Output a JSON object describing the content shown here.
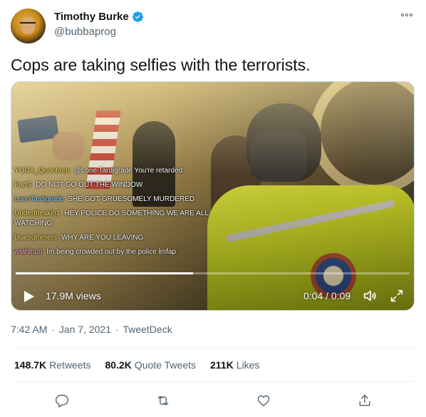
{
  "author": {
    "name": "Timothy Burke",
    "handle": "@bubbaprog",
    "verified": true
  },
  "tweet": {
    "text": "Cops are taking selfies with the terrorists."
  },
  "video": {
    "views": "17.9M views",
    "time": "0:04 / 0:09",
    "progress": 0.45,
    "overlay_chat": [
      {
        "user": "YODA_Quonteen",
        "msg": "@Lone Tardigrade You're retarded",
        "style": "yellow"
      },
      {
        "user": "KarlS",
        "msg": "DO NOT GO OUT THE WINDOW",
        "style": "yellow"
      },
      {
        "user": "LoneTardigrade",
        "msg": "SHE GOT GRUESOMELY MURDERED",
        "style": "blue"
      },
      {
        "user": "Undertheskin1",
        "msg": "HEY POLICE DO SOMETHING WE ARE ALL WATCHING",
        "style": "yellow"
      },
      {
        "user": "bluesummers",
        "msg": "WHY ARE YOU LEAVING",
        "style": "yellow"
      },
      {
        "user": "wlahlhu8",
        "msg": "Im being crowded out by the police lmfap",
        "style": "pink"
      }
    ]
  },
  "meta": {
    "time": "7:42 AM",
    "separator1": " · ",
    "date": "Jan 7, 2021",
    "separator2": " · ",
    "source": "TweetDeck"
  },
  "stats": {
    "retweets_count": "148.7K",
    "retweets_label": "Retweets",
    "quotes_count": "80.2K",
    "quotes_label": "Quote Tweets",
    "likes_count": "211K",
    "likes_label": "Likes"
  },
  "icons": {
    "reply": "reply-icon",
    "retweet": "retweet-icon",
    "like": "heart-icon",
    "share": "share-icon"
  },
  "colors": {
    "text": "#0f1419",
    "secondary": "#536471",
    "verified": "#1d9bf0",
    "border": "#eff3f4"
  }
}
